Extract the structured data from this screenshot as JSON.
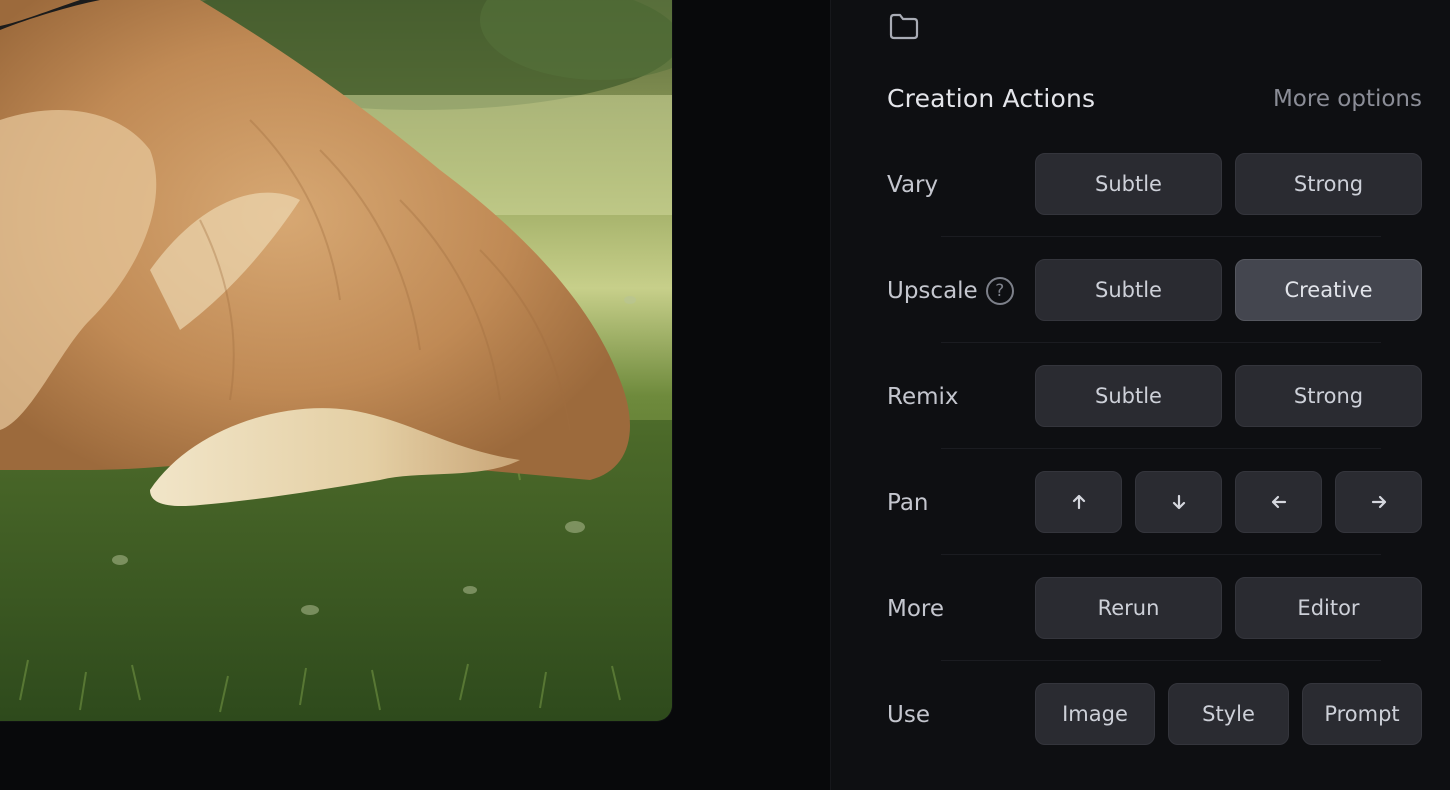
{
  "panel": {
    "title": "Creation Actions",
    "more_options": "More options",
    "icons": {
      "folder": "folder-icon",
      "help": "help-icon"
    }
  },
  "rows": {
    "vary": {
      "label": "Vary",
      "buttons": [
        "Subtle",
        "Strong"
      ]
    },
    "upscale": {
      "label": "Upscale",
      "help": "?",
      "buttons": [
        "Subtle",
        "Creative"
      ],
      "selected": "Creative"
    },
    "remix": {
      "label": "Remix",
      "buttons": [
        "Subtle",
        "Strong"
      ]
    },
    "pan": {
      "label": "Pan",
      "buttons": [
        "arrow-up-icon",
        "arrow-down-icon",
        "arrow-left-icon",
        "arrow-right-icon"
      ]
    },
    "more": {
      "label": "More",
      "buttons": [
        "Rerun",
        "Editor"
      ]
    },
    "use": {
      "label": "Use",
      "buttons": [
        "Image",
        "Style",
        "Prompt"
      ]
    }
  },
  "colors": {
    "panel_bg": "#0e0f12",
    "button_bg": "#2a2b31",
    "button_active_bg": "#44464f",
    "muted_text": "#8b8d97"
  }
}
